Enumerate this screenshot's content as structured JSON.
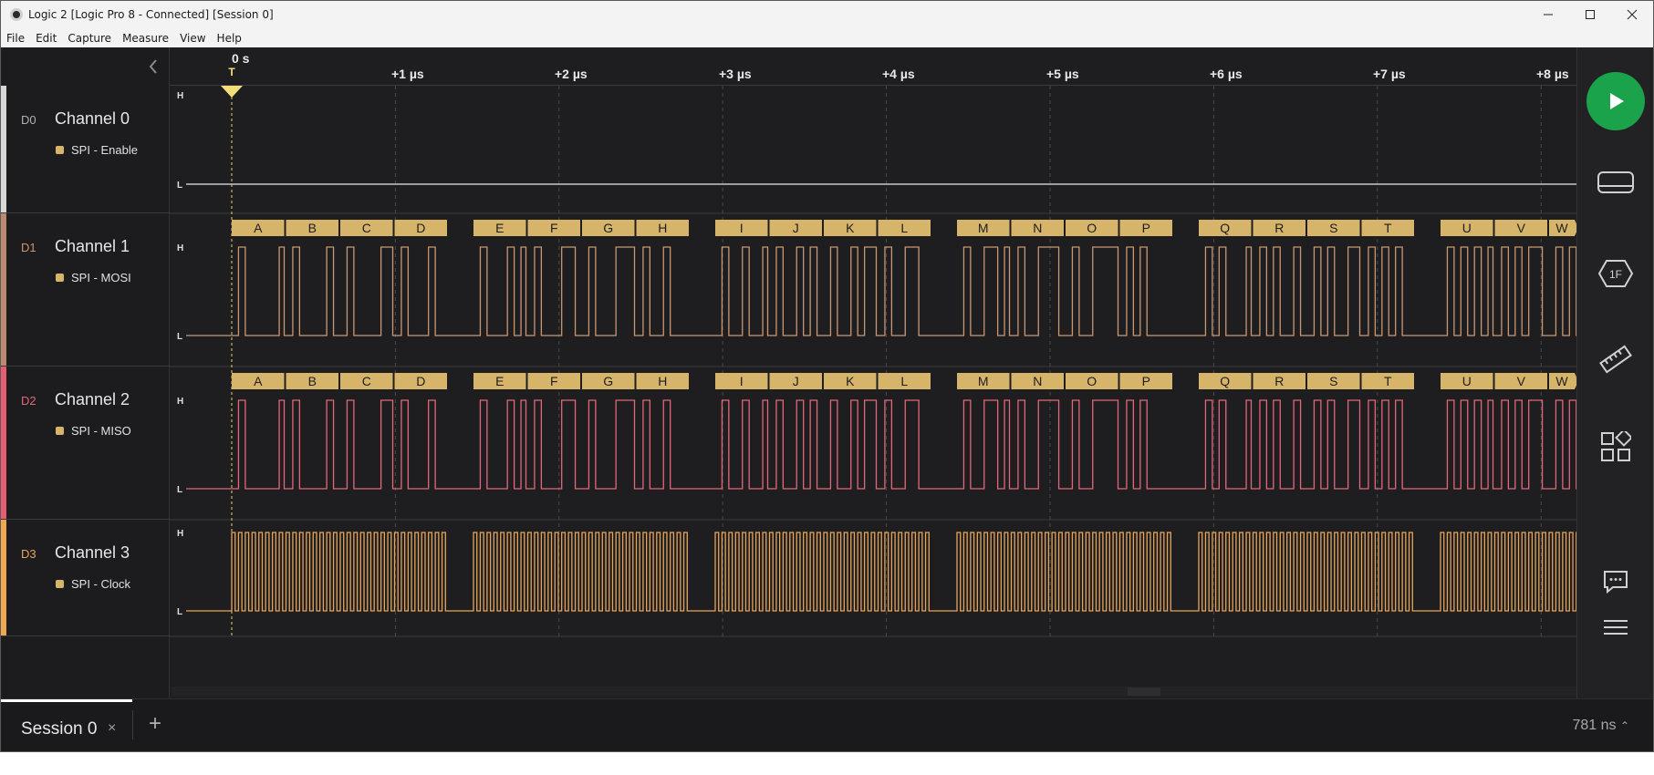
{
  "window": {
    "title": "Logic 2 [Logic Pro 8 - Connected] [Session 0]",
    "minimize_icon": "minimize-icon",
    "maximize_icon": "maximize-icon",
    "close_icon": "close-icon"
  },
  "menu": [
    "File",
    "Edit",
    "Capture",
    "Measure",
    "View",
    "Help"
  ],
  "ruler": {
    "zero_label": "0 s",
    "trigger_label": "T",
    "ticks": [
      "+1 µs",
      "+2 µs",
      "+3 µs",
      "+4 µs",
      "+5 µs",
      "+6 µs",
      "+7 µs",
      "+8 µs"
    ]
  },
  "channels": [
    {
      "id": "D0",
      "name": "Channel 0",
      "analyzer": "SPI - Enable",
      "color": "#c8c8c8",
      "stripe": "#d8d8d8"
    },
    {
      "id": "D1",
      "name": "Channel 1",
      "analyzer": "SPI - MOSI",
      "color": "#c99774",
      "stripe": "#b98a6b"
    },
    {
      "id": "D2",
      "name": "Channel 2",
      "analyzer": "SPI - MISO",
      "color": "#e2677a",
      "stripe": "#e85c72"
    },
    {
      "id": "D3",
      "name": "Channel 3",
      "analyzer": "SPI - Clock",
      "color": "#e6a55a",
      "stripe": "#f0a84f"
    }
  ],
  "level_labels": {
    "high": "H",
    "low": "L"
  },
  "decoded_bytes": [
    "A",
    "B",
    "C",
    "D",
    "E",
    "F",
    "G",
    "H",
    "I",
    "J",
    "K",
    "L",
    "M",
    "N",
    "O",
    "P",
    "Q",
    "R",
    "S",
    "T",
    "U",
    "V",
    "W"
  ],
  "decoder_color": "#d6b46a",
  "toolbar": {
    "play": "play-icon",
    "analyzers": "device-icon",
    "1f_label": "1F",
    "measure": "ruler-icon",
    "extensions": "extensions-icon",
    "comments": "comment-icon",
    "menu": "hamburger-icon"
  },
  "session": {
    "tab_label": "Session 0",
    "close_label": "×",
    "add_label": "+",
    "timing": "781 ns"
  }
}
